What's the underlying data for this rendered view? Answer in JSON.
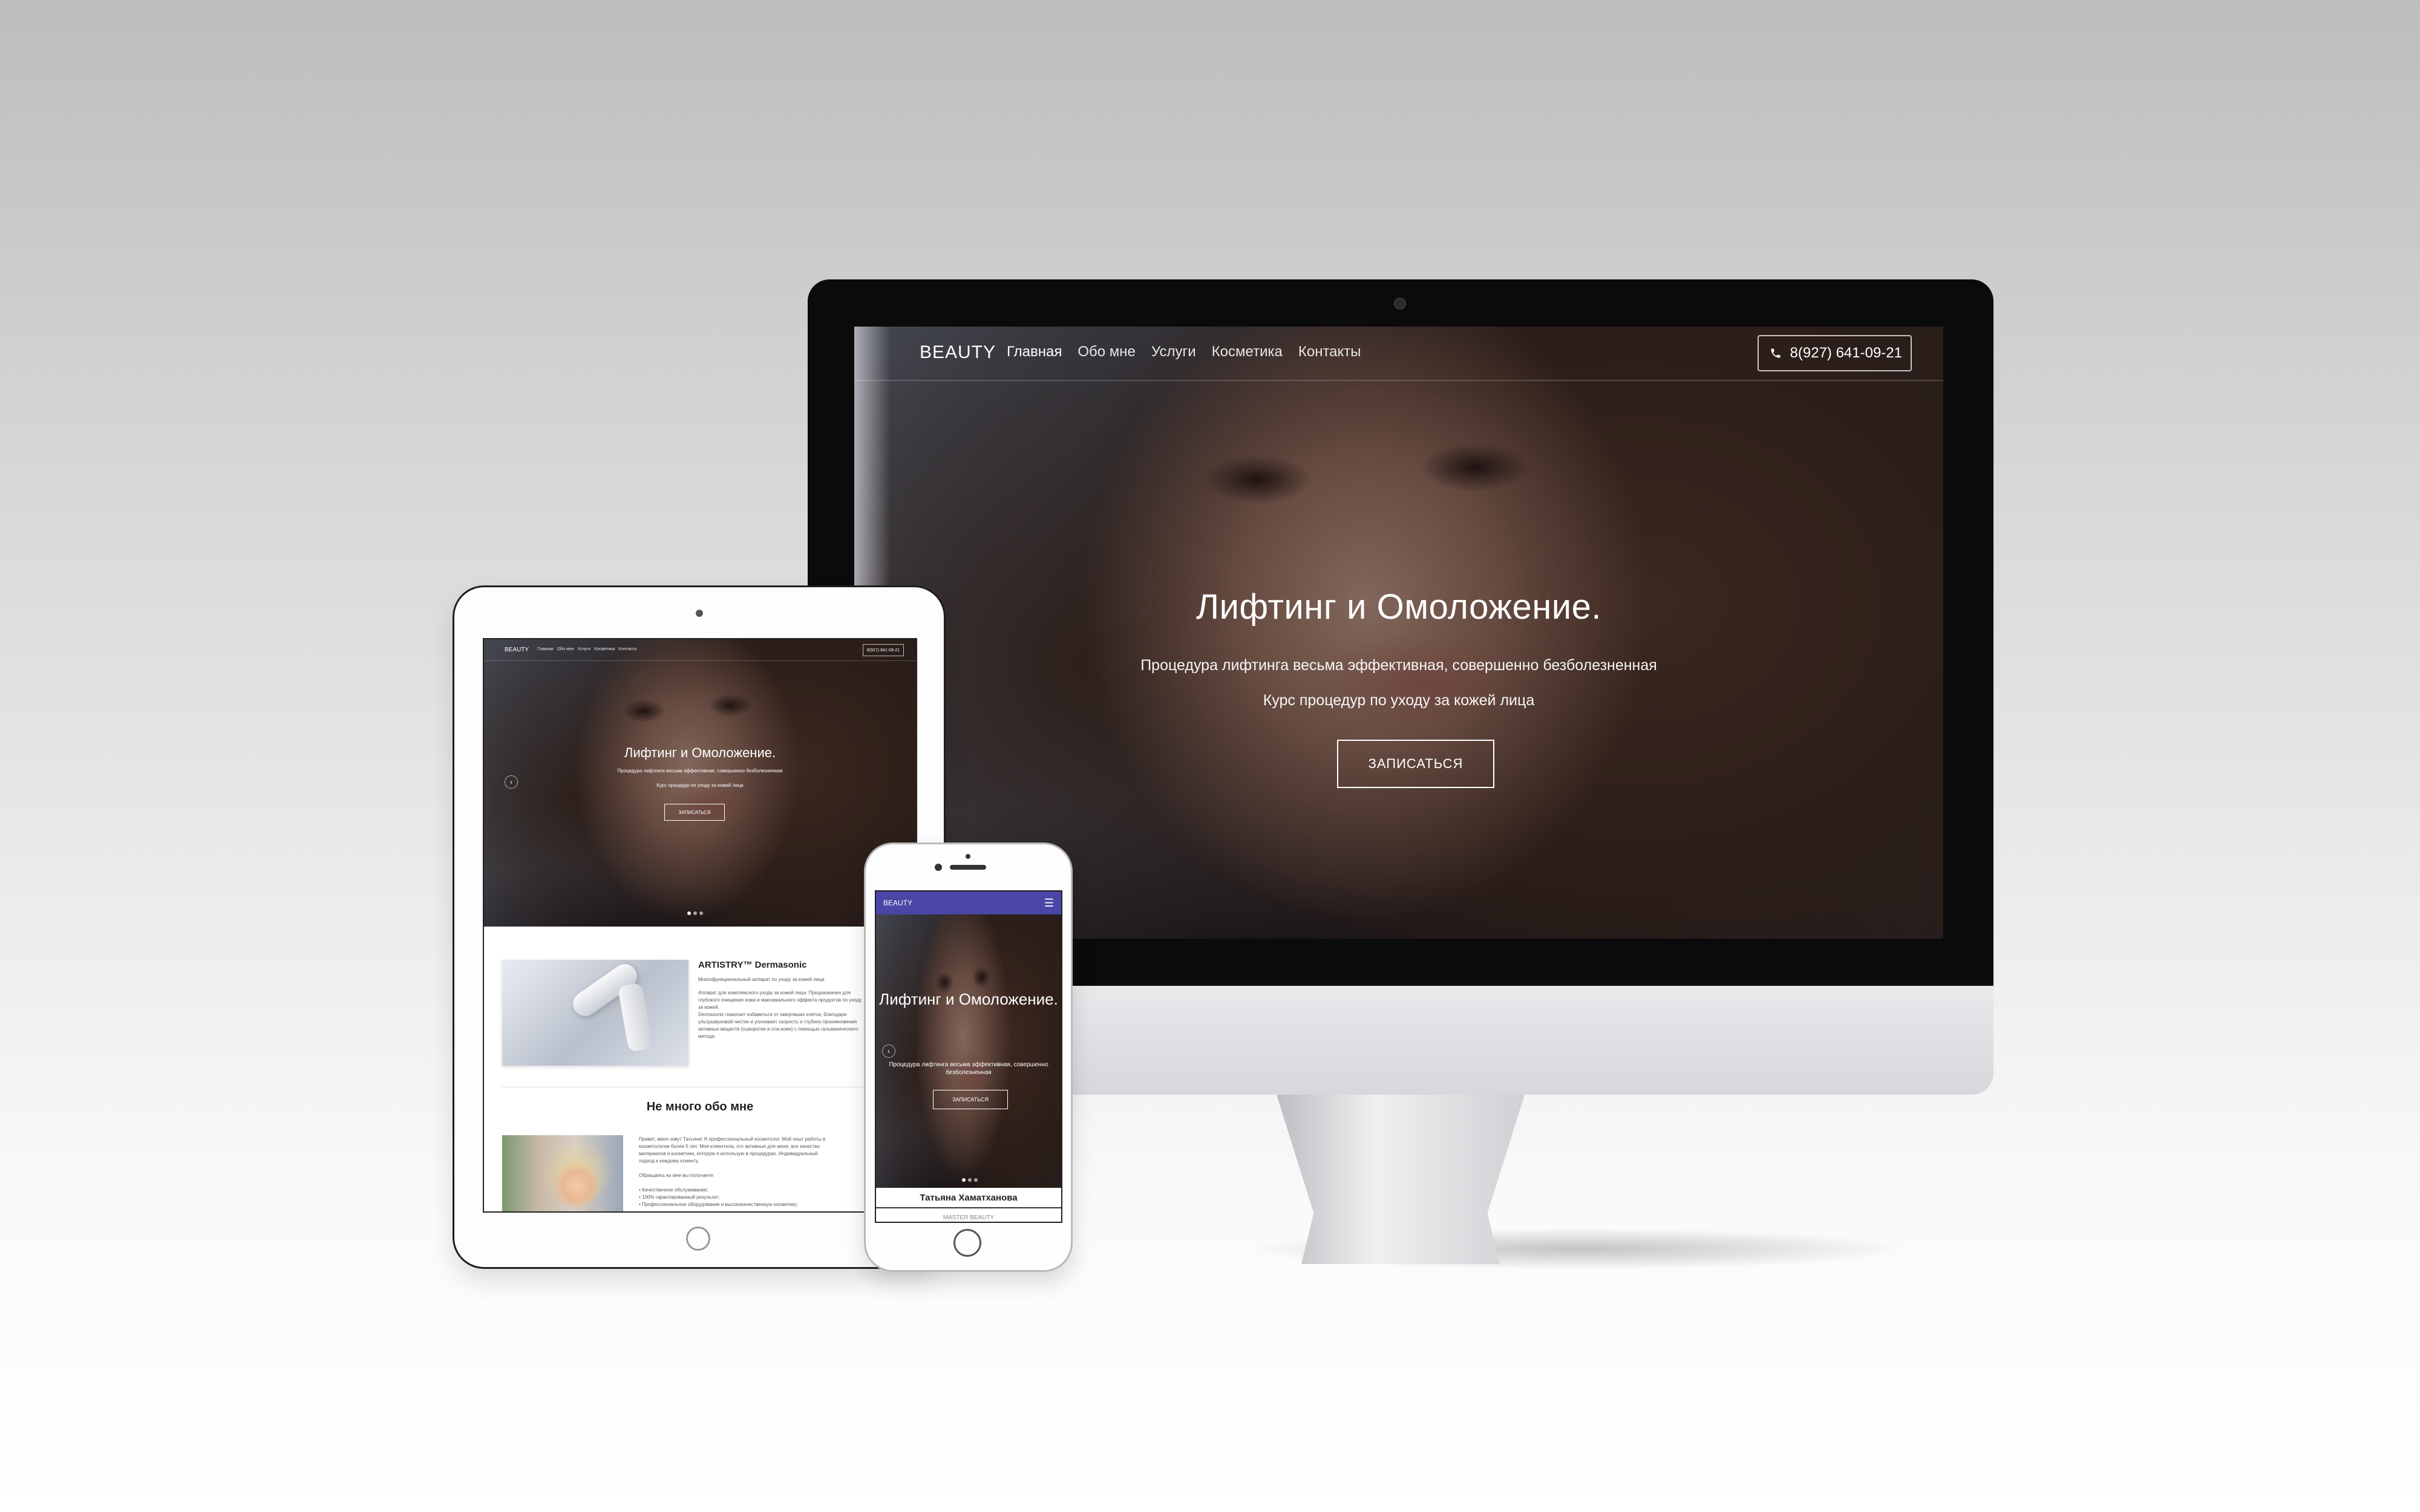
{
  "desktop": {
    "brand": "BEAUTY",
    "nav": [
      "Главная",
      "Обо мне",
      "Услуги",
      "Косметика",
      "Контакты"
    ],
    "phone": "8(927) 641-09-21",
    "hero_title": "Лифтинг и Омоложение.",
    "hero_sub1": "Процедура лифтинга весьма эффективная, совершенно безболезненная",
    "hero_sub2": "Курс процедур по уходу за кожей лица",
    "cta": "ЗАПИСАТЬСЯ"
  },
  "tablet": {
    "brand": "BEAUTY",
    "nav": [
      "Главная",
      "Обо мне",
      "Услуги",
      "Косметика",
      "Контакты"
    ],
    "phone": "8(927) 641-09-21",
    "hero_title": "Лифтинг и Омоложение.",
    "hero_sub1": "Процедура лифтинга весьма эффективная, совершенно безболезненная",
    "hero_sub2": "Курс процедур по уходу за кожей лица",
    "cta": "ЗАПИСАТЬСЯ",
    "product_title": "ARTISTRY™ Dermasonic",
    "product_lines": [
      "Многофункциональный аппарат по уходу за кожей лица",
      "Аппарат для комплексного ухода за кожей лица. Предназначен для",
      "глубокого очищения кожи и максимального эффекта продуктов по уходу",
      "за кожей.",
      "Dermasonic помогает избавиться от омертвших клеток, благодаря",
      "ультразвуковой чистке и усиливает скорость и глубину проникновения",
      "активных веществ (сыворотки и спа-кожи) с помощью гальванического",
      "метода."
    ],
    "about_title": "Не много обо мне",
    "about_lines": [
      "Привет, меня зовут Татьяна! Я профессиональный косметолог. Мой опыт работы в",
      "косметологии более 5 лет. Моя клиентела, это активные для меня, все качество",
      "материалов и косметики, которую я использую в процедурах. Индивидуальный",
      "подход к каждому клиенту.",
      "",
      "Обращаясь ко мне вы получаете:",
      "",
      "• Качественное обслуживание;",
      "• 100% гарантированный результат;",
      "• Профессиональное оборудование и высококачественную косметику;"
    ]
  },
  "mobile": {
    "brand": "BEAUTY",
    "menu_icon": "hamburger-icon",
    "hero_title": "Лифтинг и Омоложение.",
    "hero_sub": "Процедура лифтинга весьма эффективная, совершенно безболезненная",
    "cta": "ЗАПИСАТЬСЯ",
    "name": "Татьяна Хаматханова",
    "role": "MASTER BEAUTY"
  },
  "colors": {
    "mobile_navbar": "#4a46a6",
    "hero_overlay": "#1a1a2a",
    "imac_bezel": "#0b0b0b"
  }
}
